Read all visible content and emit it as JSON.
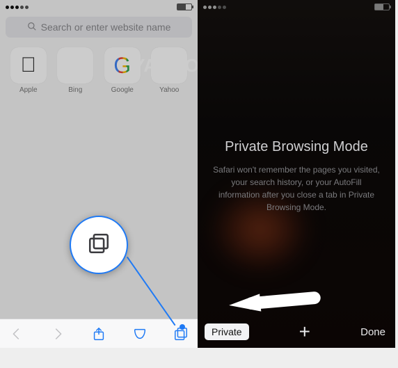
{
  "left": {
    "search_placeholder": "Search or enter website name",
    "favorites": [
      {
        "label": "Apple",
        "icon": "apple"
      },
      {
        "label": "Bing",
        "icon": "bing"
      },
      {
        "label": "Google",
        "icon": "google"
      },
      {
        "label": "Yahoo",
        "icon": "yahoo"
      }
    ]
  },
  "right": {
    "title": "Private Browsing Mode",
    "description": "Safari won't remember the pages you visited, your search history, or your AutoFill information after you close a tab in Private Browsing Mode.",
    "private_label": "Private",
    "done_label": "Done"
  }
}
